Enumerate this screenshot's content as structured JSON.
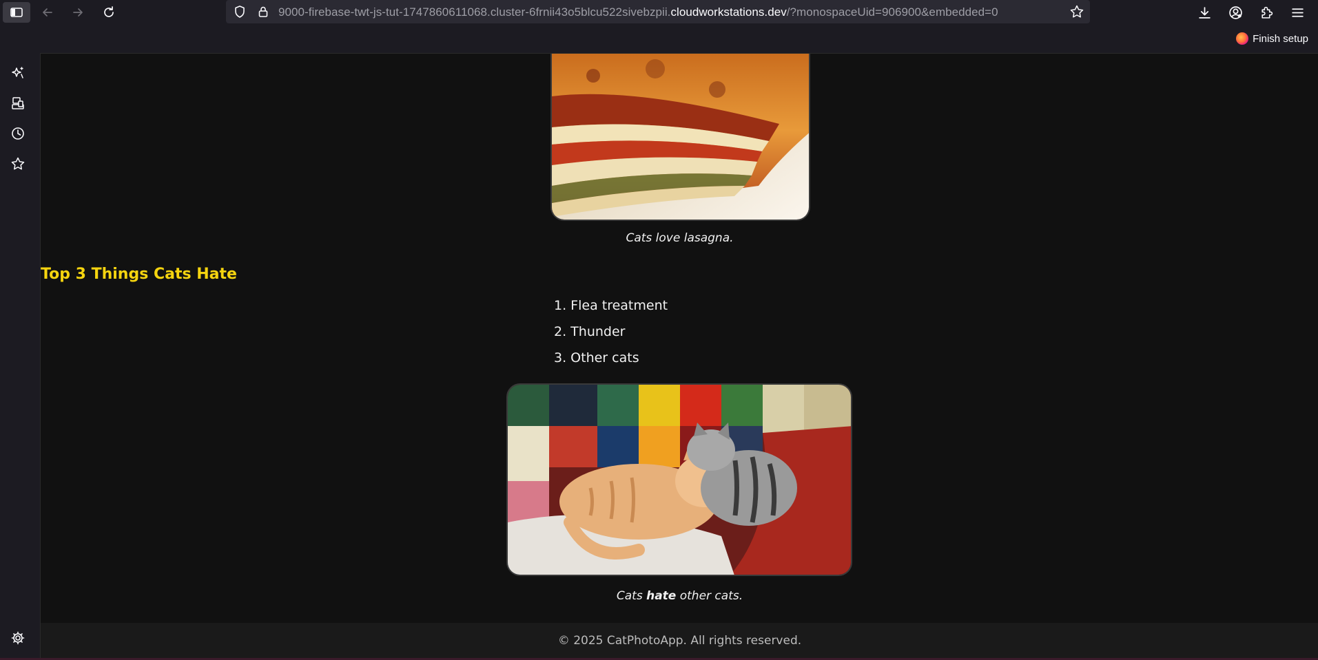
{
  "browser": {
    "url_prefix": "9000-firebase-twt-js-tut-1747860611068.cluster-6frnii43o5blcu522sivebzpii.",
    "url_host": "cloudworkstations.dev",
    "url_suffix": "/?monospaceUid=906900&embedded=0",
    "finish_setup_label": "Finish setup"
  },
  "icons": {
    "sidebar_toggle": "sidebar-icon",
    "back": "arrow-left-icon",
    "forward": "arrow-right-icon",
    "reload": "reload-icon",
    "shield": "shield-icon",
    "lock": "lock-icon",
    "bookmark": "star-icon",
    "downloads": "download-icon",
    "account": "account-icon",
    "extensions": "puzzle-icon",
    "menu": "hamburger-icon",
    "side": [
      "ai-sparkle-icon",
      "synced-tabs-icon",
      "history-icon",
      "bookmarks-icon",
      "settings-icon"
    ]
  },
  "page": {
    "caption_lasagna": "Cats love lasagna.",
    "heading_hate": "Top 3 Things Cats Hate",
    "hate_list": [
      "1. Flea treatment",
      "2. Thunder",
      "3. Other cats"
    ],
    "caption_cats_before": "Cats ",
    "caption_cats_bold": "hate",
    "caption_cats_after": " other cats.",
    "footer": "© 2025 CatPhotoApp. All rights reserved."
  },
  "colors": {
    "page_bg": "#111111",
    "heading": "#f5d40f",
    "chrome_bg": "#1c1b22",
    "urlbar_bg": "#2b2a33"
  }
}
